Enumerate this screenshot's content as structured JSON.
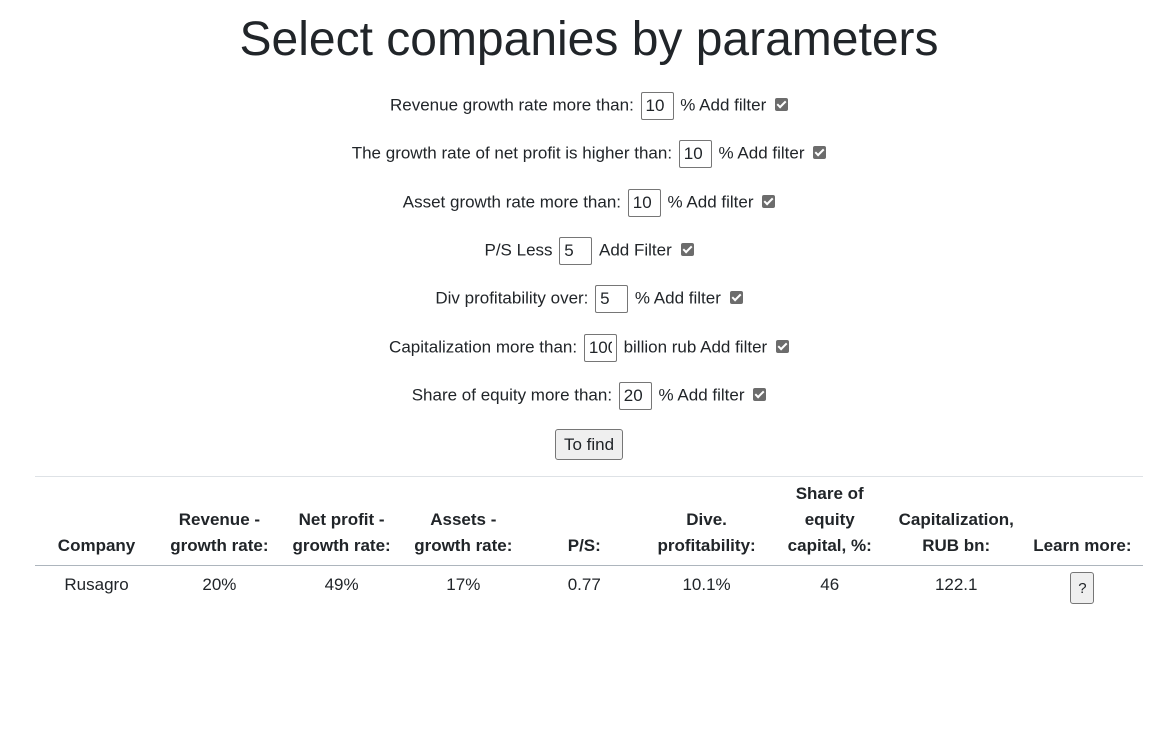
{
  "page": {
    "title": "Select companies by parameters"
  },
  "filters": [
    {
      "label": "Revenue growth rate more than:",
      "value": "10",
      "suffix": "% Add filter",
      "checked": true
    },
    {
      "label": "The growth rate of net profit is higher than:",
      "value": "10",
      "suffix": "% Add filter",
      "checked": true
    },
    {
      "label": "Asset growth rate more than:",
      "value": "10",
      "suffix": "% Add filter",
      "checked": true
    },
    {
      "label": "P/S Less",
      "value": "5",
      "suffix": "Add Filter",
      "checked": true
    },
    {
      "label": "Div profitability over:",
      "value": "5",
      "suffix": "% Add filter",
      "checked": true
    },
    {
      "label": "Capitalization more than:",
      "value": "100",
      "suffix": "billion rub Add filter",
      "checked": true
    },
    {
      "label": "Share of equity more than:",
      "value": "20",
      "suffix": "% Add filter",
      "checked": true
    }
  ],
  "find_button": {
    "label": "To find"
  },
  "table": {
    "headers": {
      "company": "Company",
      "revenue_1": "Revenue -",
      "revenue_2": "growth rate:",
      "profit_1": "Net profit -",
      "profit_2": "growth rate:",
      "assets_1": "Assets -",
      "assets_2": "growth rate:",
      "ps": "P/S:",
      "div_1": "Dive.",
      "div_2": "profitability:",
      "equity_1": "Share of",
      "equity_2": "equity",
      "equity_3": "capital, %:",
      "cap_1": "Capitalization,",
      "cap_2": "RUB bn:",
      "more": "Learn more:"
    },
    "rows": [
      {
        "company": "Rusagro",
        "revenue_growth": "20%",
        "profit_growth": "49%",
        "assets_growth": "17%",
        "ps": "0.77",
        "div_profitability": "10.1%",
        "equity_share": "46",
        "capitalization": "122.1",
        "more_label": "?"
      }
    ]
  },
  "icons": {
    "checkbox": "checkbox-checked-icon"
  }
}
